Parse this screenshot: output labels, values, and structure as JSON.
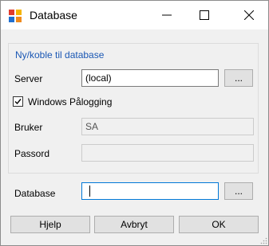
{
  "window": {
    "title": "Database",
    "icon": "database-app-icon",
    "controls": {
      "minimize": "minimize-icon",
      "maximize": "maximize-icon",
      "close": "close-icon"
    }
  },
  "group": {
    "legend": "Ny/koble til database",
    "server": {
      "label": "Server",
      "value": "(local)",
      "browse_label": "..."
    },
    "windows_login": {
      "label": "Windows Pålogging",
      "checked": true
    },
    "user": {
      "label": "Bruker",
      "value": "SA"
    },
    "password": {
      "label": "Passord",
      "value": ""
    }
  },
  "database": {
    "label": "Database",
    "value": "",
    "browse_label": "..."
  },
  "buttons": {
    "help": "Hjelp",
    "cancel": "Avbryt",
    "ok": "OK"
  },
  "colors": {
    "group_legend": "#1a57b4",
    "focus_border": "#0078d7"
  }
}
